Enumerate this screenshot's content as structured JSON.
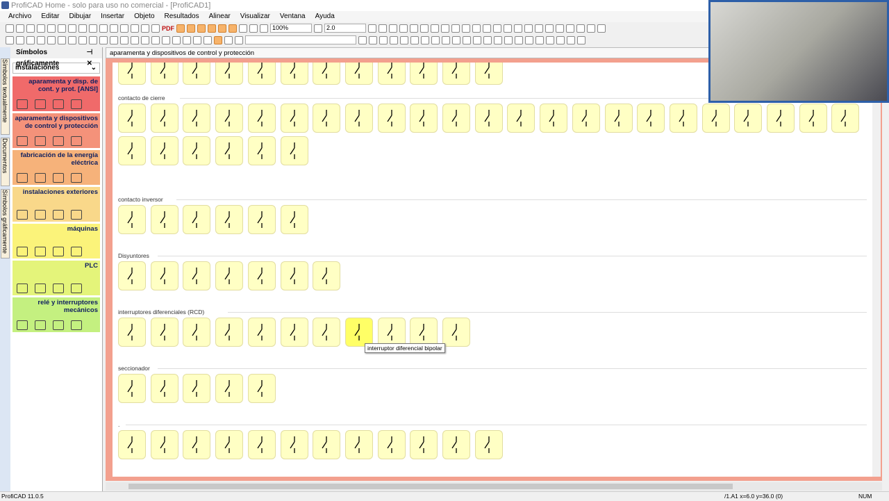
{
  "window": {
    "title": "ProfiCAD Home - solo para uso no comercial - [ProfiCAD1]"
  },
  "menu": [
    "Archivo",
    "Editar",
    "Dibujar",
    "Insertar",
    "Objeto",
    "Resultados",
    "Alinear",
    "Visualizar",
    "Ventana",
    "Ayuda"
  ],
  "toolbar": {
    "zoom": "100%",
    "line_width": "2.0",
    "pdf_label": "PDF"
  },
  "vertical_tabs": [
    "Símbolos textualmente",
    "Documentos",
    "Símbolos gráficamente"
  ],
  "panel": {
    "title": "Símbolos gráficamente",
    "category_select": "instalaciónes",
    "categories": [
      {
        "label": "aparamenta y disp. de cont. y prot. [ANSI]",
        "color": "#f06a6a"
      },
      {
        "label": "aparamenta y dispositivos de control y protección",
        "color": "#f4927a"
      },
      {
        "label": "fabricación de la energía eléctrica",
        "color": "#f6b27a"
      },
      {
        "label": "instalaciones exteriores",
        "color": "#f9d88a"
      },
      {
        "label": "máquinas",
        "color": "#fbf37a"
      },
      {
        "label": "PLC",
        "color": "#e4f47a"
      },
      {
        "label": "relé y interruptores mecánicos",
        "color": "#c4f080"
      }
    ]
  },
  "document": {
    "tab": "aparamenta y dispositivos de control y protección",
    "sections": [
      {
        "label": "",
        "count": 12
      },
      {
        "label": "contacto de cierre",
        "count": 29
      },
      {
        "label": "contacto inversor",
        "count": 6
      },
      {
        "label": "Disyuntores",
        "count": 7
      },
      {
        "label": "interruptores diferenciales (RCD)",
        "count": 11,
        "highlighted": 8
      },
      {
        "label": "seccionador",
        "count": 5
      },
      {
        "label": ".",
        "count": 12
      }
    ],
    "tooltip": "interruptor diferencial bipolar"
  },
  "status": {
    "left": "ProfiCAD 11.0.5",
    "coords": "/1.A1  x=6.0  y=36.0 (0)",
    "num": "NUM"
  },
  "colors": {
    "frame": "#f3a08e",
    "tile": "#ffffc4",
    "tile_highlight": "#ffff66"
  }
}
